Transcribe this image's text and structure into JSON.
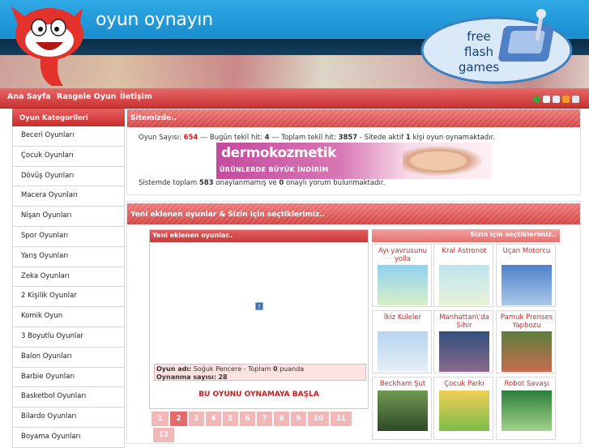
{
  "header": {
    "site_title": "oyun oynayın",
    "ffg_text": [
      "free",
      "flash",
      "games"
    ]
  },
  "nav": {
    "items": [
      "Ana Sayfa",
      "Rasgele Oyun",
      "İletişim"
    ],
    "icons": [
      "check-icon",
      "home-icon",
      "mail-icon",
      "rss-icon",
      "bookmark-icon"
    ]
  },
  "sidebar": {
    "title": "Oyun Kategorileri",
    "items": [
      "Beceri Oyunları",
      "Çocuk Oyunları",
      "Dövüş Oyunları",
      "Macera Oyunları",
      "Nişan Oyunları",
      "Spor Oyunları",
      "Yarış Oyunları",
      "Zeka Oyunları",
      "2 Kişilik Oyunlar",
      "Komik Oyun",
      "3 Boyutlu Oyunlar",
      "Balon Oyunları",
      "Barbie Oyunları",
      "Basketbol Oyunları",
      "Bilardo Oyunları",
      "Boyama Oyunları"
    ]
  },
  "site_panel": {
    "title": "Sitemizde..",
    "stats": {
      "label_games": "Oyun Sayısı:",
      "games": "654",
      "sep1": "--- Bugün tekil hit:",
      "today_hits": "4",
      "sep2": "--- Toplam tekil hit:",
      "total_hits": "3857",
      "sep3": "- Sitede aktif",
      "active": "1",
      "sep4": "kişi oyun oynamaktadır."
    },
    "banner": {
      "brand": "dermokozmetik",
      "tagline": "ÜRÜNLERDE BÜYÜK İNDİRİM"
    },
    "comments": {
      "pre": "Sistemde toplam",
      "unapproved": "583",
      "mid": "onaylanmamış ve",
      "approved": "0",
      "post": "onaylı yorum bulunmaktadır."
    }
  },
  "new_panel": {
    "title": "Yeni eklenen oyunlar & Sizin için seçtiklerimiz..",
    "new_box": {
      "title": "Yeni eklenen oyunlar..",
      "game_label": "Oyun adı:",
      "game_name": "Soğuk Pencere",
      "total_label": "- Toplam",
      "points": "0",
      "points_suffix": "puanda",
      "plays_label": "Oynanma sayısı:",
      "plays": "28",
      "play_button": "BU OYUNU OYNAMAYA BAŞLA"
    },
    "pages": [
      "1",
      "2",
      "3",
      "4",
      "5",
      "6",
      "7",
      "8",
      "9",
      "10",
      "11",
      "12"
    ],
    "active_page": "2",
    "picks": {
      "title": "Sizin için seçtiklerimiz..",
      "games": [
        {
          "title": "Ayı yavrusunu yolla",
          "color": "#7fc3e6"
        },
        {
          "title": "Kral Astronot",
          "color": "#9fc9d8"
        },
        {
          "title": "Uçan Motorcu",
          "color": "#5b8fcf"
        },
        {
          "title": "İkiz Kuleler",
          "color": "#a6c7e6"
        },
        {
          "title": "Manhattan\\'da Sihir",
          "color": "#3f5d8f"
        },
        {
          "title": "Pamuk Prenses Yapbozu",
          "color": "#6d8e4f"
        },
        {
          "title": "Beckham Şut",
          "color": "#7aa35a"
        },
        {
          "title": "Çocuk Parkı",
          "color": "#e7c347"
        },
        {
          "title": "Robot Savaşı",
          "color": "#2f8d3e"
        }
      ]
    }
  }
}
